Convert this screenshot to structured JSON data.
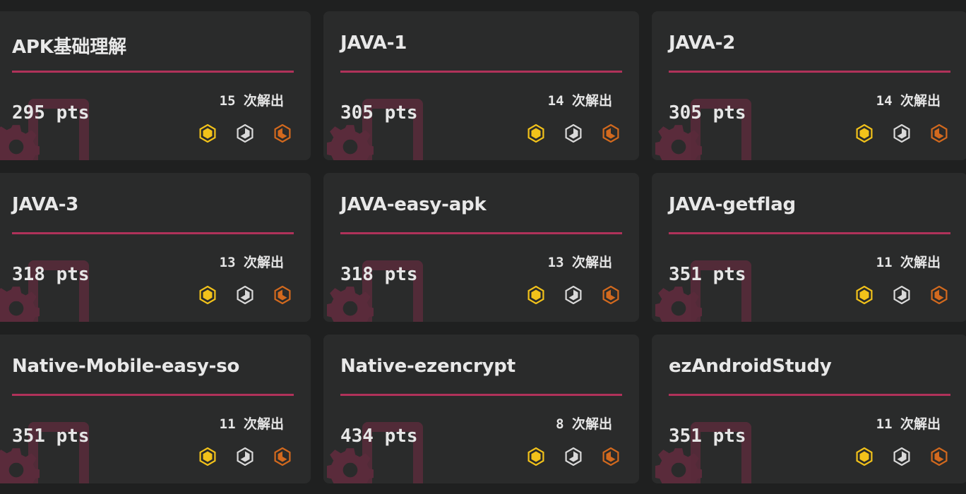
{
  "colors": {
    "background": "#1f2020",
    "card": "#2a2b2b",
    "accent": "#b0325a",
    "gold": "#f2c21a",
    "silver": "#d9d9d9",
    "bronze": "#d2691e"
  },
  "solves_suffix": "次解出",
  "challenges": [
    {
      "title": "APK基础理解",
      "points": "295 pts",
      "solves": "15 次解出"
    },
    {
      "title": "JAVA-1",
      "points": "305 pts",
      "solves": "14 次解出"
    },
    {
      "title": "JAVA-2",
      "points": "305 pts",
      "solves": "14 次解出"
    },
    {
      "title": "JAVA-3",
      "points": "318 pts",
      "solves": "13 次解出"
    },
    {
      "title": "JAVA-easy-apk",
      "points": "318 pts",
      "solves": "13 次解出"
    },
    {
      "title": "JAVA-getflag",
      "points": "351 pts",
      "solves": "11 次解出"
    },
    {
      "title": "Native-Mobile-easy-so",
      "points": "351 pts",
      "solves": "11 次解出"
    },
    {
      "title": "Native-ezencrypt",
      "points": "434 pts",
      "solves": "8 次解出"
    },
    {
      "title": "ezAndroidStudy",
      "points": "351 pts",
      "solves": "11 次解出"
    }
  ],
  "medal_icons": [
    "gold-medal-icon",
    "silver-medal-icon",
    "bronze-medal-icon"
  ]
}
